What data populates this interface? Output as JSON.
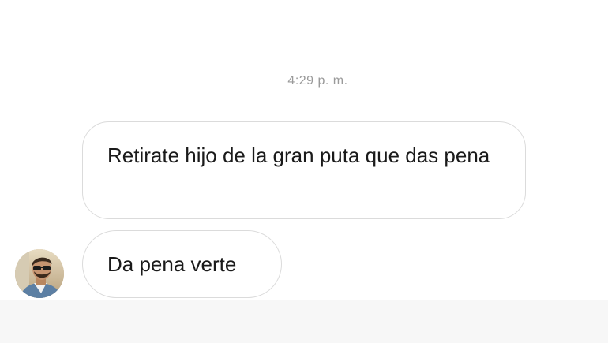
{
  "conversation": {
    "timestamp": "4:29 p. m.",
    "messages": [
      {
        "text": "Retirate hijo de la gran puta que das pena"
      },
      {
        "text": "Da pena verte"
      }
    ],
    "avatar_icon": "user-avatar-photo"
  },
  "colors": {
    "background": "#ffffff",
    "bubble_border": "#dbdbdb",
    "timestamp_text": "#9a9a9a",
    "message_text": "#1a1a1a"
  }
}
